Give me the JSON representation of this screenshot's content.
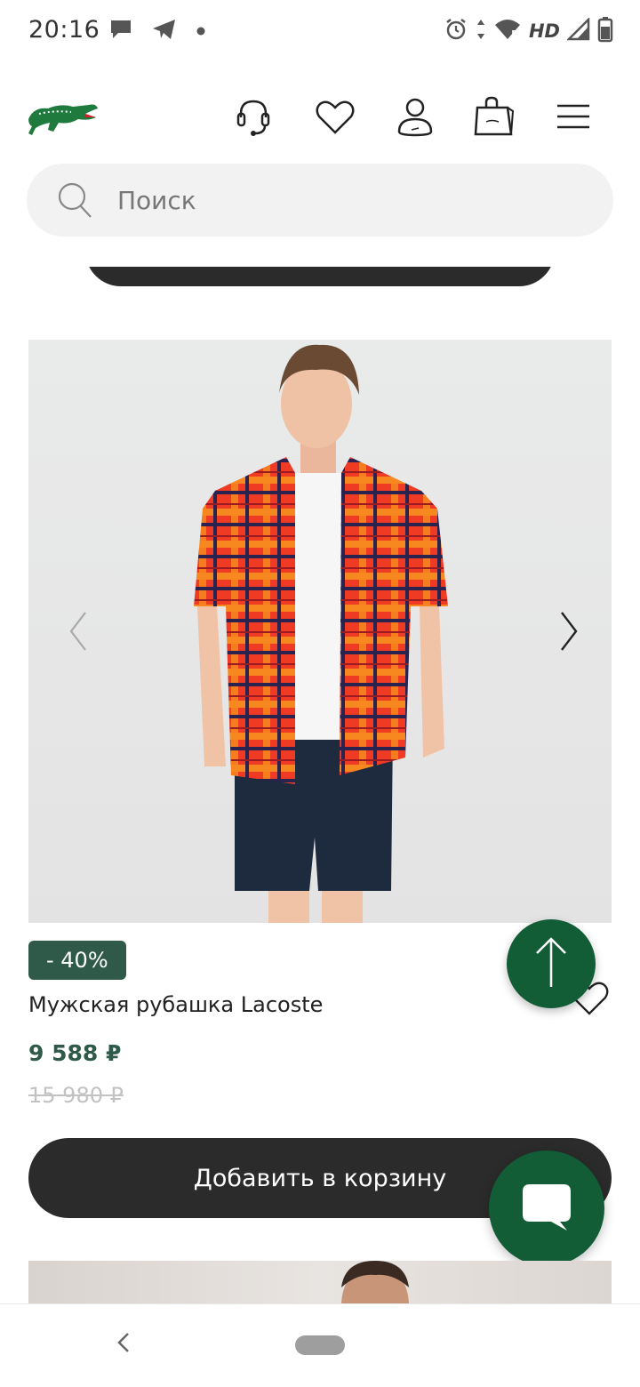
{
  "status_bar": {
    "time": "20:16",
    "hd_label": "HD",
    "signal_sub": "5",
    "left_icons": [
      "chat-bubble-icon",
      "telegram-icon",
      "dot-icon"
    ],
    "right_icons": [
      "alarm-icon",
      "data-arrows-icon",
      "wifi-icon",
      "signal-icon",
      "battery-icon"
    ]
  },
  "header": {
    "logo": "lacoste-crocodile-logo",
    "icons": [
      "headset-icon",
      "heart-icon",
      "user-icon",
      "shopping-bag-icon",
      "menu-icon"
    ]
  },
  "search": {
    "placeholder": "Поиск"
  },
  "product": {
    "image_alt": "Мужская рубашка Lacoste",
    "discount": "- 40%",
    "title": "Мужская рубашка Lacoste",
    "price_current": "9 588 ₽",
    "price_old": "15 980 ₽",
    "add_to_cart": "Добавить в корзину"
  },
  "colors": {
    "brand_green": "#125c36",
    "badge_green": "#2f5a4a",
    "button_dark": "#2b2b2b",
    "old_price": "#c2c2c2"
  }
}
